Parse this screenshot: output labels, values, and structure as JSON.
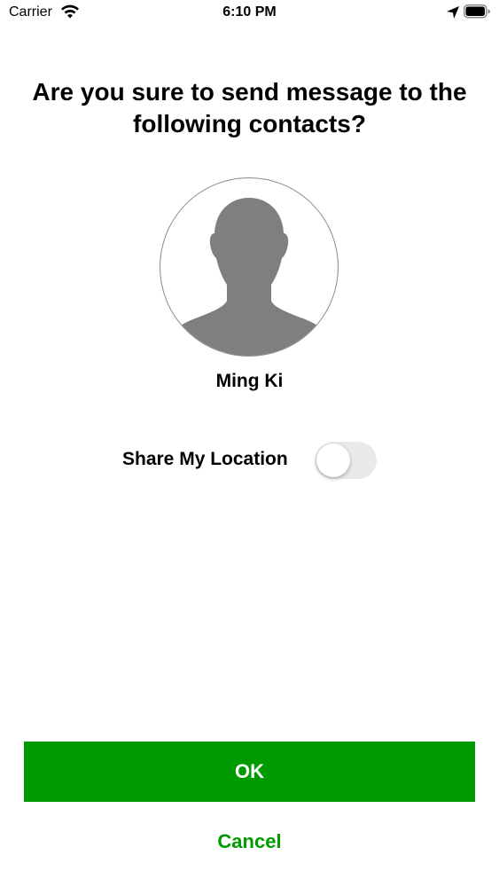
{
  "status_bar": {
    "carrier": "Carrier",
    "time": "6:10 PM",
    "icons": [
      "wifi-icon",
      "location-arrow-icon",
      "battery-icon"
    ]
  },
  "dialog": {
    "title": "Are you sure to send message to the following contacts?",
    "contact": {
      "name": "Ming Ki",
      "avatar_icon": "person-silhouette-icon"
    },
    "share_location": {
      "label": "Share My Location",
      "enabled": false
    }
  },
  "buttons": {
    "ok_label": "OK",
    "cancel_label": "Cancel"
  },
  "colors": {
    "accent": "#009b00",
    "toggle_off": "#e9e9eb",
    "avatar_silhouette": "#7f7f82"
  }
}
